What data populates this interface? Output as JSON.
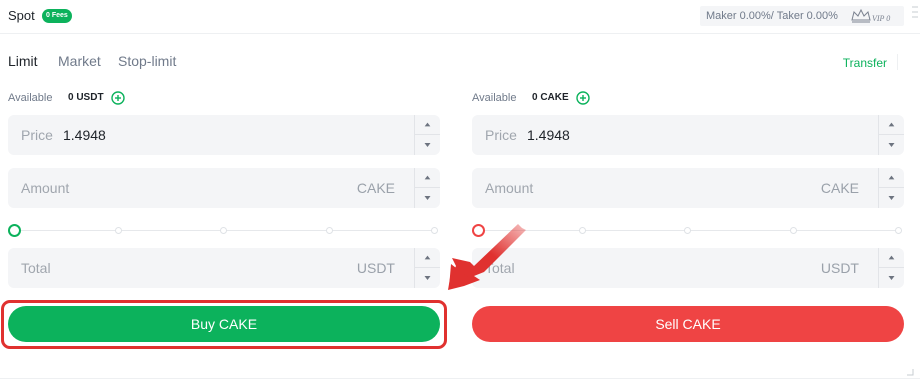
{
  "header": {
    "title": "Spot",
    "fees_badge": "0 Fees",
    "fee_info": "Maker 0.00%/ Taker 0.00%",
    "vip_label": "VIP 0"
  },
  "tabs": [
    {
      "label": "Limit",
      "active": true
    },
    {
      "label": "Market",
      "active": false
    },
    {
      "label": "Stop-limit",
      "active": false
    }
  ],
  "transfer_label": "Transfer",
  "buy": {
    "available_label": "Available",
    "available_value": "0 USDT",
    "price_label": "Price",
    "price_value": "1.4948",
    "amount_placeholder": "Amount",
    "amount_unit": "CAKE",
    "slider_percent": 0,
    "total_placeholder": "Total",
    "total_unit": "USDT",
    "button_label": "Buy CAKE",
    "color": "#0cb25c"
  },
  "sell": {
    "available_label": "Available",
    "available_value": "0 CAKE",
    "price_label": "Price",
    "price_value": "1.4948",
    "amount_placeholder": "Amount",
    "amount_unit": "CAKE",
    "slider_percent": 0,
    "total_placeholder": "Total",
    "total_unit": "USDT",
    "button_label": "Sell CAKE",
    "color": "#ef4444"
  },
  "annotation_color": "#e0312f"
}
